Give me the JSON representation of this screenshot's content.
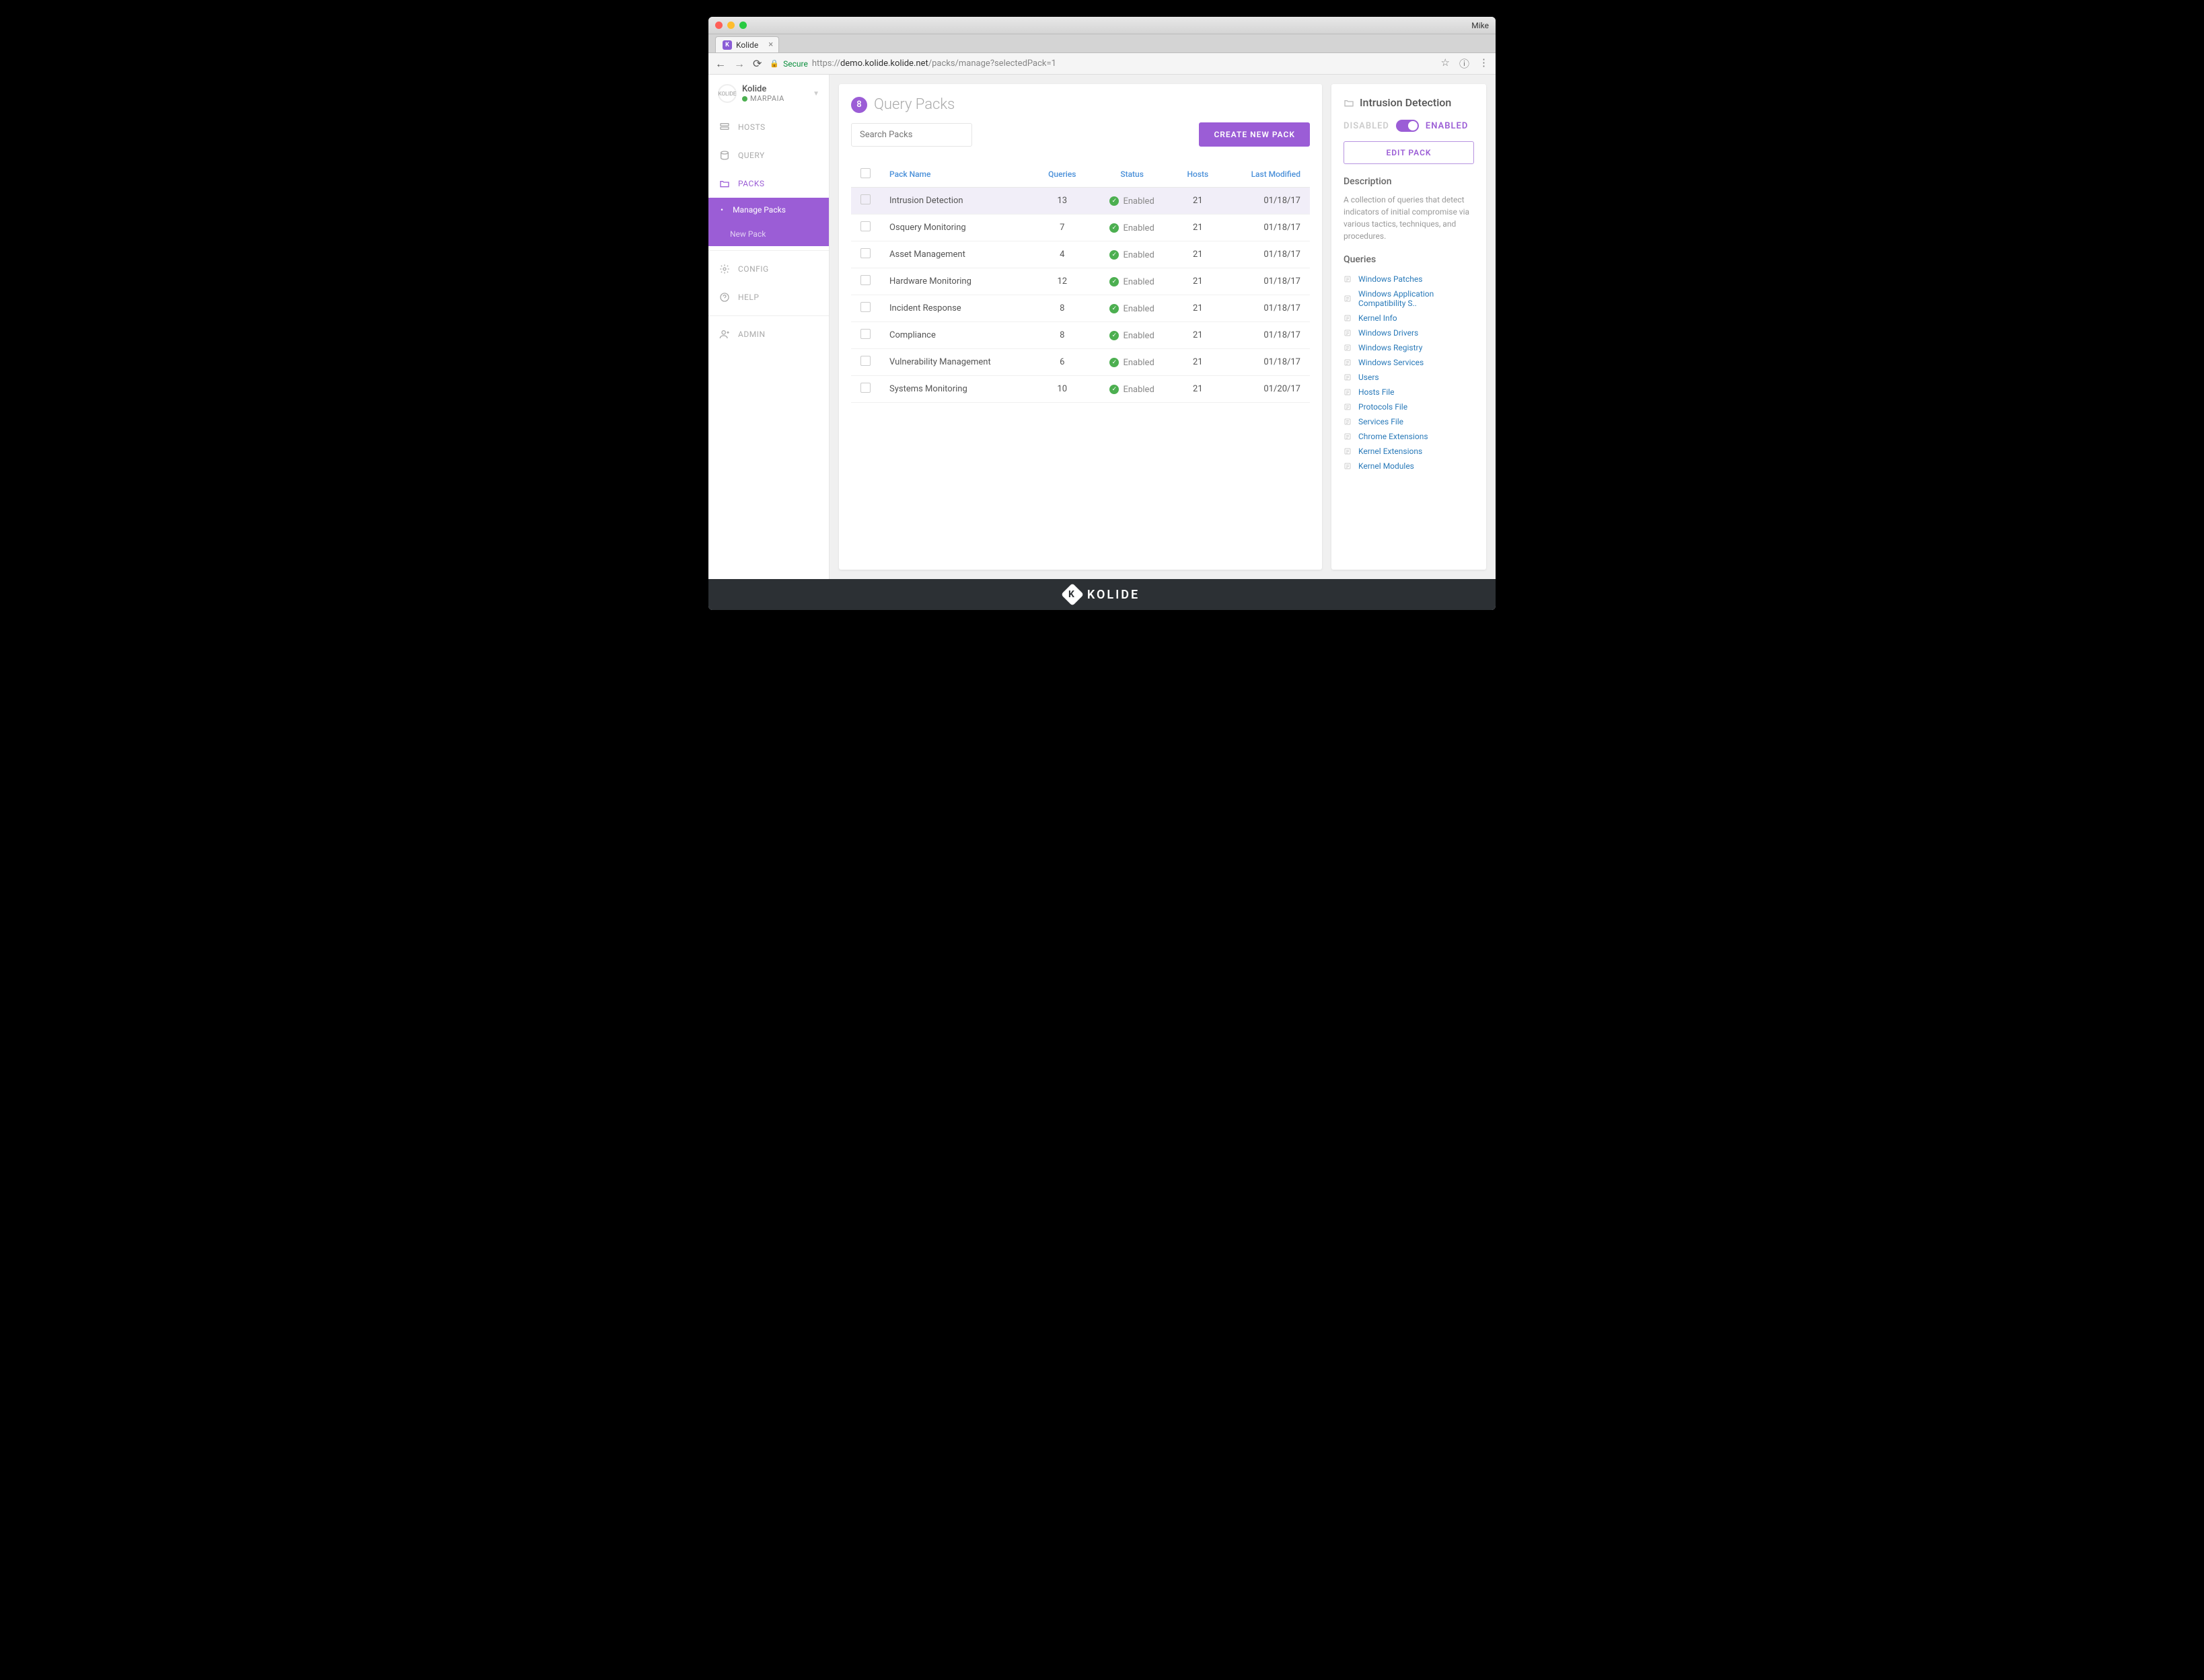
{
  "browser": {
    "profile": "Mike",
    "tab_title": "Kolide",
    "secure_label": "Secure",
    "url_host": "demo.kolide.kolide.net",
    "url_path": "/packs/manage?selectedPack=1",
    "url_prefix": "https://"
  },
  "brand": {
    "name": "Kolide",
    "user": "MARPAIA",
    "logo_text": "KOLIDE"
  },
  "nav": {
    "hosts": "HOSTS",
    "query": "QUERY",
    "packs": "PACKS",
    "manage_packs": "Manage Packs",
    "new_pack": "New Pack",
    "config": "CONFIG",
    "help": "HELP",
    "admin": "ADMIN"
  },
  "page": {
    "count": "8",
    "title": "Query Packs",
    "search_placeholder": "Search Packs",
    "create_button": "CREATE NEW PACK"
  },
  "table": {
    "headers": {
      "name": "Pack Name",
      "queries": "Queries",
      "status": "Status",
      "hosts": "Hosts",
      "modified": "Last Modified"
    },
    "rows": [
      {
        "name": "Intrusion Detection",
        "queries": "13",
        "status": "Enabled",
        "hosts": "21",
        "modified": "01/18/17",
        "selected": true
      },
      {
        "name": "Osquery Monitoring",
        "queries": "7",
        "status": "Enabled",
        "hosts": "21",
        "modified": "01/18/17"
      },
      {
        "name": "Asset Management",
        "queries": "4",
        "status": "Enabled",
        "hosts": "21",
        "modified": "01/18/17"
      },
      {
        "name": "Hardware Monitoring",
        "queries": "12",
        "status": "Enabled",
        "hosts": "21",
        "modified": "01/18/17"
      },
      {
        "name": "Incident Response",
        "queries": "8",
        "status": "Enabled",
        "hosts": "21",
        "modified": "01/18/17"
      },
      {
        "name": "Compliance",
        "queries": "8",
        "status": "Enabled",
        "hosts": "21",
        "modified": "01/18/17"
      },
      {
        "name": "Vulnerability Management",
        "queries": "6",
        "status": "Enabled",
        "hosts": "21",
        "modified": "01/18/17"
      },
      {
        "name": "Systems Monitoring",
        "queries": "10",
        "status": "Enabled",
        "hosts": "21",
        "modified": "01/20/17"
      }
    ]
  },
  "panel": {
    "title": "Intrusion Detection",
    "disabled_label": "DISABLED",
    "enabled_label": "ENABLED",
    "edit_button": "EDIT PACK",
    "desc_label": "Description",
    "description": "A collection of queries that detect indicators of initial compromise via various tactics, techniques, and procedures.",
    "queries_label": "Queries",
    "queries": [
      "Windows Patches",
      "Windows Application Compatibility S..",
      "Kernel Info",
      "Windows Drivers",
      "Windows Registry",
      "Windows Services",
      "Users",
      "Hosts File",
      "Protocols File",
      "Services File",
      "Chrome Extensions",
      "Kernel Extensions",
      "Kernel Modules"
    ]
  },
  "footer": {
    "text": "KOLIDE"
  }
}
